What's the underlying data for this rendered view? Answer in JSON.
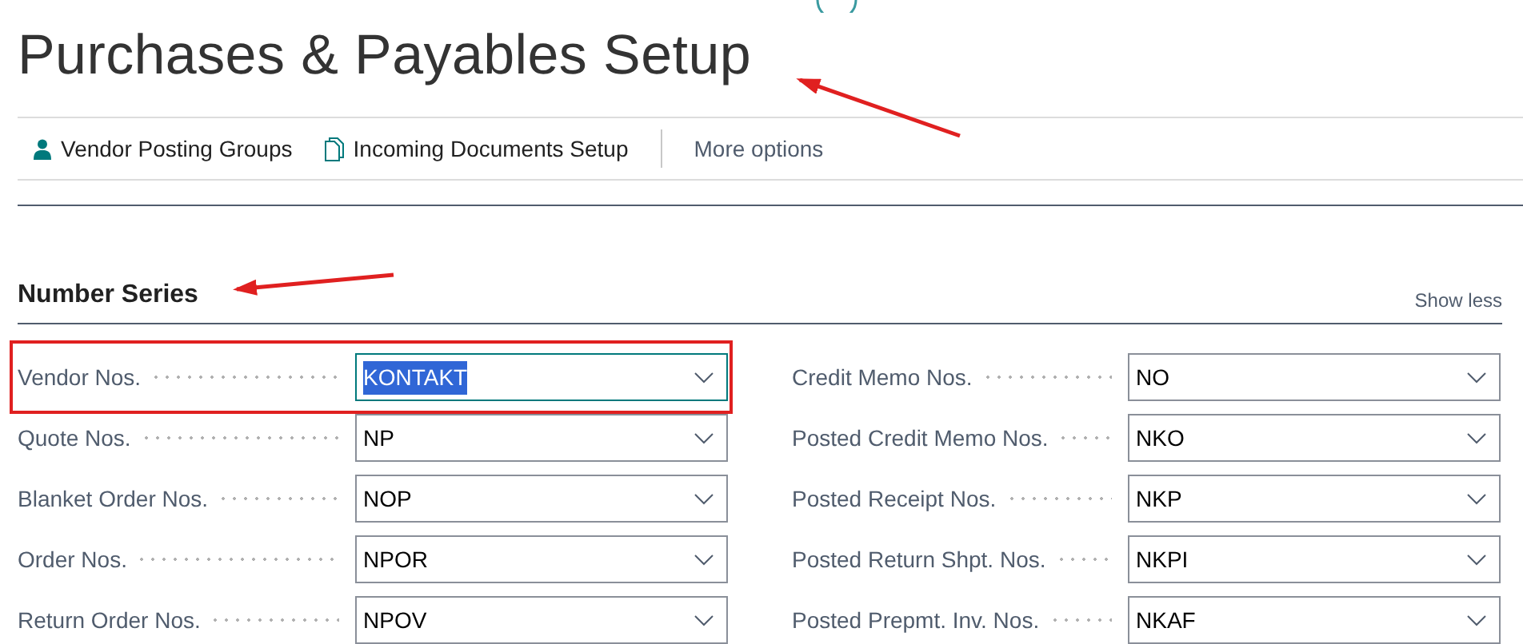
{
  "page": {
    "title": "Purchases & Payables Setup"
  },
  "actions": [
    {
      "label": "Vendor Posting Groups",
      "kind": "person"
    },
    {
      "label": "Incoming Documents Setup",
      "kind": "document"
    },
    {
      "label": "More options",
      "kind": "more"
    }
  ],
  "section": {
    "title": "Number Series",
    "toggle": "Show less",
    "columns": [
      [
        {
          "label": "Vendor Nos.",
          "value": "KONTAKT",
          "focused": true,
          "highlighted": true
        },
        {
          "label": "Quote Nos.",
          "value": "NP",
          "focused": false,
          "highlighted": false
        },
        {
          "label": "Blanket Order Nos.",
          "value": "NOP",
          "focused": false,
          "highlighted": false
        },
        {
          "label": "Order Nos.",
          "value": "NPOR",
          "focused": false,
          "highlighted": false
        },
        {
          "label": "Return Order Nos.",
          "value": "NPOV",
          "focused": false,
          "highlighted": false
        }
      ],
      [
        {
          "label": "Credit Memo Nos.",
          "value": "NO",
          "focused": false,
          "highlighted": false
        },
        {
          "label": "Posted Credit Memo Nos.",
          "value": "NKO",
          "focused": false,
          "highlighted": false
        },
        {
          "label": "Posted Receipt Nos.",
          "value": "NKP",
          "focused": false,
          "highlighted": false
        },
        {
          "label": "Posted Return Shpt. Nos.",
          "value": "NKPI",
          "focused": false,
          "highlighted": false
        },
        {
          "label": "Posted Prepmt. Inv. Nos.",
          "value": "NKAF",
          "focused": false,
          "highlighted": false
        }
      ]
    ]
  }
}
